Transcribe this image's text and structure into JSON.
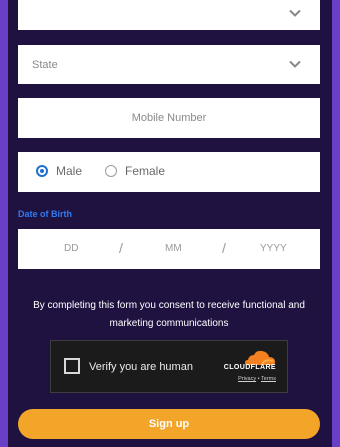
{
  "form": {
    "top_select": {
      "value": ""
    },
    "state_select": {
      "label": "State"
    },
    "mobile": {
      "placeholder": "Mobile Number"
    },
    "gender": {
      "options": [
        "Male",
        "Female"
      ],
      "selected": "Male"
    },
    "dob": {
      "label": "Date of Birth",
      "dd": "DD",
      "mm": "MM",
      "yyyy": "YYYY",
      "separator": "/"
    },
    "consent": {
      "line1": "By completing this form you consent to receive functional and",
      "line2": "marketing communications"
    },
    "captcha": {
      "label": "Verify you are human",
      "brand": "CLOUDFLARE",
      "privacy": "Privacy",
      "dot": "•",
      "terms": "Terms"
    },
    "signup_label": "Sign up"
  },
  "colors": {
    "background": "#1f1240",
    "edge": "#6a3fc8",
    "accent_blue": "#2f7bf5",
    "button_orange": "#f3a52a",
    "cloudflare_orange": "#f48120"
  },
  "icons": {
    "select_arrow": "chevron-down-icon",
    "captcha_logo": "cloudflare-cloud-icon"
  }
}
